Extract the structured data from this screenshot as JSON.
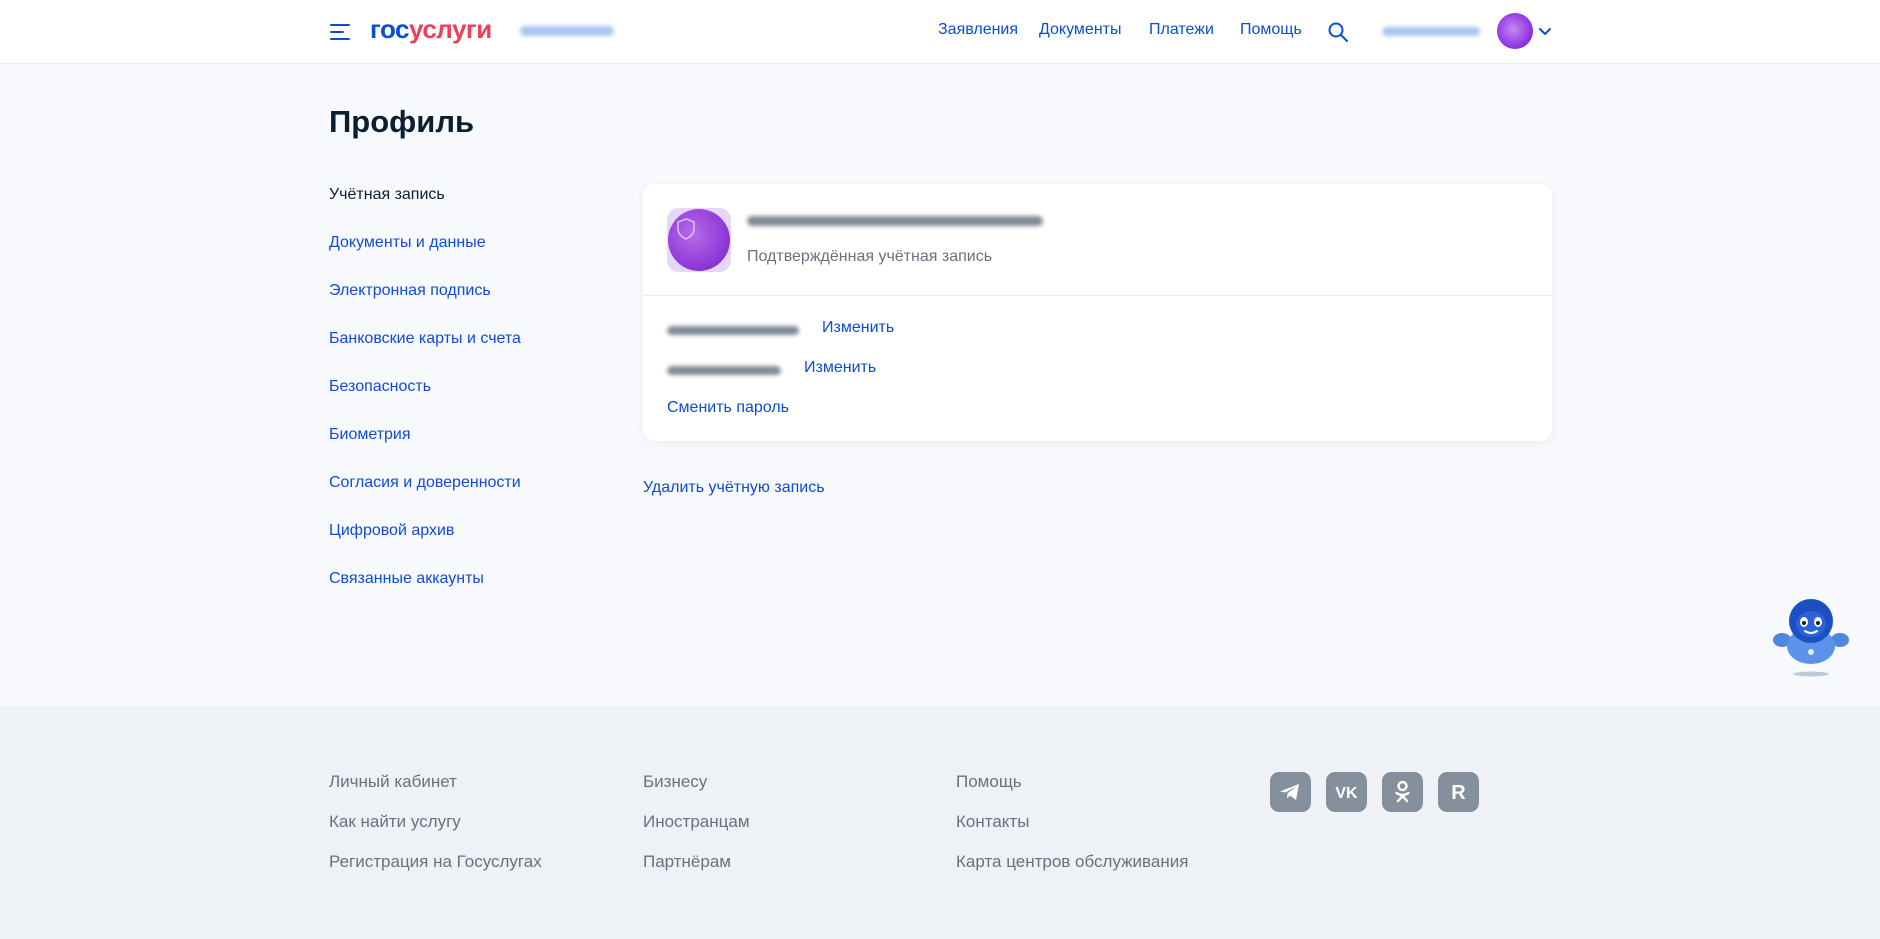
{
  "header": {
    "logo_part1": "гос",
    "logo_part2": "услуги",
    "nav": [
      "Заявления",
      "Документы",
      "Платежи",
      "Помощь"
    ],
    "icons": {
      "menu": "hamburger-menu-icon",
      "search": "search-icon",
      "dropdown": "chevron-down-icon"
    }
  },
  "page": {
    "title": "Профиль"
  },
  "sidebar": {
    "items": [
      {
        "label": "Учётная запись",
        "active": true
      },
      {
        "label": "Документы и данные",
        "active": false
      },
      {
        "label": "Электронная подпись",
        "active": false
      },
      {
        "label": "Банковские карты и счета",
        "active": false
      },
      {
        "label": "Безопасность",
        "active": false
      },
      {
        "label": "Биометрия",
        "active": false
      },
      {
        "label": "Согласия и доверенности",
        "active": false
      },
      {
        "label": "Цифровой архив",
        "active": false
      },
      {
        "label": "Связанные аккаунты",
        "active": false
      }
    ]
  },
  "account": {
    "status": "Подтверждённая учётная запись",
    "phone_change": "Изменить",
    "email_change": "Изменить",
    "change_password": "Сменить пароль",
    "delete": "Удалить учётную запись"
  },
  "footer": {
    "col1": [
      "Личный кабинет",
      "Как найти услугу",
      "Регистрация на Госуслугах"
    ],
    "col2": [
      "Бизнесу",
      "Иностранцам",
      "Партнёрам"
    ],
    "col3": [
      "Помощь",
      "Контакты",
      "Карта центров обслуживания"
    ],
    "social": [
      "telegram-icon",
      "vk-icon",
      "odnoklassniki-icon",
      "rutube-icon"
    ]
  },
  "colors": {
    "accent": "#0d4cd3",
    "brand_red": "#ee3f58",
    "text": "#0b1f33",
    "muted": "#66727f",
    "background": "#f8f9fd",
    "footer_background": "#eef2f7"
  }
}
